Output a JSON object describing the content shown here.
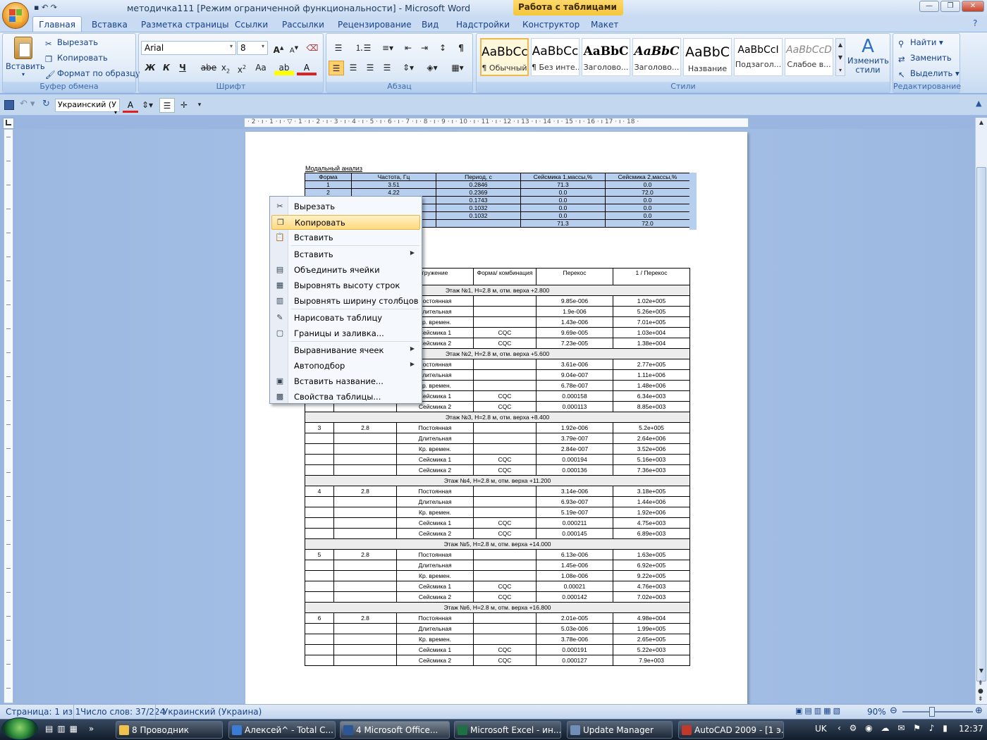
{
  "window": {
    "title": "методичка111 [Режим ограниченной функциональности] - Microsoft Word",
    "context_tab": "Работа с таблицами"
  },
  "tabs": [
    "Главная",
    "Вставка",
    "Разметка страницы",
    "Ссылки",
    "Рассылки",
    "Рецензирование",
    "Вид",
    "Надстройки",
    "Конструктор",
    "Макет"
  ],
  "clipboard": {
    "paste": "Вставить",
    "cut": "Вырезать",
    "copy": "Копировать",
    "format": "Формат по образцу",
    "label": "Буфер обмена"
  },
  "font": {
    "name": "Arial",
    "size": "8",
    "label": "Шрифт",
    "bold": "Ж",
    "italic": "К",
    "underline": "Ч",
    "strike": "abe",
    "aa": "Aa"
  },
  "paragraph": {
    "label": "Абзац"
  },
  "styles": {
    "label": "Стили",
    "items": [
      {
        "sample": "AaBbCc",
        "name": "¶ Обычный"
      },
      {
        "sample": "AaBbCc",
        "name": "¶ Без инте..."
      },
      {
        "sample": "AaBbC",
        "name": "Заголово..."
      },
      {
        "sample": "AaBbC",
        "name": "Заголово..."
      },
      {
        "sample": "AaBbC",
        "name": "Название"
      },
      {
        "sample": "AaBbCcI",
        "name": "Подзагол..."
      },
      {
        "sample": "AaBbCcD",
        "name": "Слабое в..."
      }
    ],
    "change": "Изменить стили"
  },
  "editing": {
    "find": "Найти",
    "replace": "Заменить",
    "select": "Выделить",
    "label": "Редактирование"
  },
  "qat": {
    "language": "Украинский (У"
  },
  "ruler": "· 2 · ı · 1 · ı · ▽ · 1 · ı · 2 · ı · 3 · ı · 4 · ı · 5 · ı · 6 · ı · 7 · ı · 8 · ı · 9 · ı · 10 · ı · 11 · ı · 12 · ı 13 · ı · 14 · ı · 15 · ı · 16 · ı 17 · ı · 18 ·",
  "doc": {
    "heading": "Модальный анализ",
    "modal_headers": [
      "Форма",
      "Частота, Гц",
      "Период, с",
      "Сейсмика 1,массы,%",
      "Сейсмика 2,массы,%"
    ],
    "modal_rows": [
      [
        "1",
        "3.51",
        "0.2846",
        "71.3",
        "0.0"
      ],
      [
        "2",
        "4.22",
        "0.2369",
        "0.0",
        "72.0"
      ],
      [
        "",
        "",
        "0.1743",
        "0.0",
        "0.0"
      ],
      [
        "",
        "",
        "0.1032",
        "0.0",
        "0.0"
      ],
      [
        "",
        "",
        "0.1032",
        "0.0",
        "0.0"
      ],
      [
        "",
        "",
        "",
        "71.3",
        "72.0"
      ]
    ],
    "drift_headers": [
      "",
      "",
      "гружение",
      "Форма/ комбинация",
      "Перекос",
      "1 / Перекос"
    ],
    "floors": [
      {
        "title": "Этаж №1, H=2.8 м, отм. верха +2.800",
        "num": "",
        "h": "",
        "rows": [
          [
            "Постоянная",
            "",
            "9.85e-006",
            "1.02e+005"
          ],
          [
            "Длительная",
            "",
            "1.9e-006",
            "5.26e+005"
          ],
          [
            "Кр. времен.",
            "",
            "1.43e-006",
            "7.01e+005"
          ],
          [
            "Сейсмика 1",
            "CQC",
            "9.69e-005",
            "1.03e+004"
          ],
          [
            "Сейсмика 2",
            "CQC",
            "7.23e-005",
            "1.38e+004"
          ]
        ]
      },
      {
        "title": "Этаж №2, H=2.8 м, отм. верха +5.600",
        "num": "",
        "h": "",
        "rows": [
          [
            "Постоянная",
            "",
            "3.61e-006",
            "2.77e+005"
          ],
          [
            "Длительная",
            "",
            "9.04e-007",
            "1.11e+006"
          ],
          [
            "Кр. времен.",
            "",
            "6.78e-007",
            "1.48e+006"
          ],
          [
            "Сейсмика 1",
            "CQC",
            "0.000158",
            "6.34e+003"
          ],
          [
            "Сейсмика 2",
            "CQC",
            "0.000113",
            "8.85e+003"
          ]
        ]
      },
      {
        "title": "Этаж №3, H=2.8 м, отм. верха +8.400",
        "num": "3",
        "h": "2.8",
        "rows": [
          [
            "Постоянная",
            "",
            "1.92e-006",
            "5.2e+005"
          ],
          [
            "Длительная",
            "",
            "3.79e-007",
            "2.64e+006"
          ],
          [
            "Кр. времен.",
            "",
            "2.84e-007",
            "3.52e+006"
          ],
          [
            "Сейсмика 1",
            "CQC",
            "0.000194",
            "5.16e+003"
          ],
          [
            "Сейсмика 2",
            "CQC",
            "0.000136",
            "7.36e+003"
          ]
        ]
      },
      {
        "title": "Этаж №4, H=2.8 м, отм. верха +11.200",
        "num": "4",
        "h": "2.8",
        "rows": [
          [
            "Постоянная",
            "",
            "3.14e-006",
            "3.18e+005"
          ],
          [
            "Длительная",
            "",
            "6.93e-007",
            "1.44e+006"
          ],
          [
            "Кр. времен.",
            "",
            "5.19e-007",
            "1.92e+006"
          ],
          [
            "Сейсмика 1",
            "CQC",
            "0.000211",
            "4.75e+003"
          ],
          [
            "Сейсмика 2",
            "CQC",
            "0.000145",
            "6.89e+003"
          ]
        ]
      },
      {
        "title": "Этаж №5, H=2.8 м, отм. верха +14.000",
        "num": "5",
        "h": "2.8",
        "rows": [
          [
            "Постоянная",
            "",
            "6.13e-006",
            "1.63e+005"
          ],
          [
            "Длительная",
            "",
            "1.45e-006",
            "6.92e+005"
          ],
          [
            "Кр. времен.",
            "",
            "1.08e-006",
            "9.22e+005"
          ],
          [
            "Сейсмика 1",
            "CQC",
            "0.00021",
            "4.76e+003"
          ],
          [
            "Сейсмика 2",
            "CQC",
            "0.000142",
            "7.02e+003"
          ]
        ]
      },
      {
        "title": "Этаж №6, H=2.8 м, отм. верха +16.800",
        "num": "6",
        "h": "2.8",
        "rows": [
          [
            "Постоянная",
            "",
            "2.01e-005",
            "4.98e+004"
          ],
          [
            "Длительная",
            "",
            "5.03e-006",
            "1.99e+005"
          ],
          [
            "Кр. времен.",
            "",
            "3.78e-006",
            "2.65e+005"
          ],
          [
            "Сейсмика 1",
            "CQC",
            "0.000191",
            "5.22e+003"
          ],
          [
            "Сейсмика 2",
            "CQC",
            "0.000127",
            "7.9e+003"
          ]
        ]
      }
    ]
  },
  "context_menu": [
    {
      "label": "Вырезать",
      "icon": "scissors-icon",
      "sel": false,
      "arrow": false
    },
    {
      "label": "Копировать",
      "icon": "copy-icon",
      "sel": true,
      "arrow": false
    },
    {
      "label": "Вставить",
      "icon": "paste-icon",
      "sel": false,
      "arrow": false
    },
    {
      "label": "Вставить",
      "icon": "",
      "sel": false,
      "arrow": true
    },
    {
      "label": "Объединить ячейки",
      "icon": "merge-cells-icon",
      "sel": false,
      "arrow": false
    },
    {
      "label": "Выровнять высоту строк",
      "icon": "distribute-rows-icon",
      "sel": false,
      "arrow": false
    },
    {
      "label": "Выровнять ширину столбцов",
      "icon": "distribute-columns-icon",
      "sel": false,
      "arrow": false
    },
    {
      "label": "Нарисовать таблицу",
      "icon": "draw-table-icon",
      "sel": false,
      "arrow": false
    },
    {
      "label": "Границы и заливка...",
      "icon": "borders-icon",
      "sel": false,
      "arrow": false
    },
    {
      "label": "Выравнивание ячеек",
      "icon": "",
      "sel": false,
      "arrow": true
    },
    {
      "label": "Автоподбор",
      "icon": "",
      "sel": false,
      "arrow": true
    },
    {
      "label": "Вставить название...",
      "icon": "caption-icon",
      "sel": false,
      "arrow": false
    },
    {
      "label": "Свойства таблицы...",
      "icon": "table-properties-icon",
      "sel": false,
      "arrow": false
    }
  ],
  "status": {
    "page": "Страница: 1 из 1",
    "words": "Число слов: 37/224",
    "lang": "Украинский (Украина)",
    "zoom": "90%"
  },
  "taskbar": {
    "items": [
      {
        "label": "8 Проводник",
        "color": "#f0c24b"
      },
      {
        "label": "Алексей^ - Total C...",
        "color": "#3a7bd5"
      },
      {
        "label": "4 Microsoft Office...",
        "color": "#2b5797"
      },
      {
        "label": "Microsoft Excel - ин...",
        "color": "#1e7145"
      },
      {
        "label": "Update Manager",
        "color": "#6f8fb8"
      },
      {
        "label": "AutoCAD 2009 - [1 э...",
        "color": "#c0392b"
      }
    ],
    "lang": "UK",
    "time": "12:37"
  }
}
